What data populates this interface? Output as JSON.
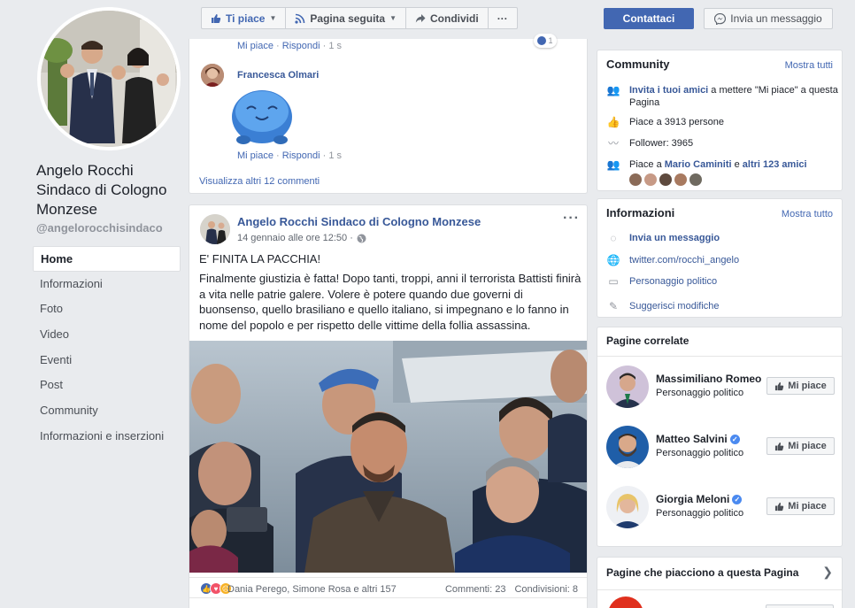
{
  "page": {
    "name": "Angelo Rocchi Sindaco di Cologno Monzese",
    "handle": "@angelorocchisindaco"
  },
  "nav": [
    {
      "label": "Home",
      "active": true
    },
    {
      "label": "Informazioni"
    },
    {
      "label": "Foto"
    },
    {
      "label": "Video"
    },
    {
      "label": "Eventi"
    },
    {
      "label": "Post"
    },
    {
      "label": "Community"
    },
    {
      "label": "Informazioni e inserzioni"
    }
  ],
  "actionbar": {
    "like_label": "Ti piace",
    "follow_label": "Pagina seguita",
    "share_label": "Condividi",
    "more_label": "···",
    "contact_label": "Contattaci",
    "message_label": "Invia un messaggio"
  },
  "comments": {
    "first_actions": {
      "like": "Mi piace",
      "reply": "Rispondi",
      "time": "1 s"
    },
    "reaction_count": "1",
    "commenter": "Francesca Olmari",
    "second_actions": {
      "like": "Mi piace",
      "reply": "Rispondi",
      "time": "1 s"
    },
    "view_more": "Visualizza altri 12 commenti",
    "separator": "·"
  },
  "post": {
    "author": "Angelo Rocchi Sindaco di Cologno Monzese",
    "date": "14 gennaio alle ore 12:50 ·",
    "headline": "E' FINITA LA PACCHIA!",
    "text": "Finalmente giustizia è fatta! Dopo tanti, troppi, anni il terrorista Battisti finirà a vita nelle patrie galere. Volere è potere quando due governi di buonsenso, quello brasiliano e quello italiano, si impegnano e lo fanno in nome del popolo e per rispetto delle vittime della follia assassina.",
    "reactions": "Dania Perego, Simone Rosa e altri 157",
    "comments_count": "Commenti: 23",
    "shares_count": "Condivisioni: 8"
  },
  "community": {
    "title": "Community",
    "see_all": "Mostra tutti",
    "invite_link": "Invita i tuoi amici",
    "invite_rest": " a mettere \"Mi piace\" a questa Pagina",
    "likes": "Piace a 3913 persone",
    "followers": "Follower: 3965",
    "friends_prefix": "Piace a ",
    "friends_name": "Mario Caminiti",
    "friends_mid": " e ",
    "friends_more": "altri 123 amici"
  },
  "info": {
    "title": "Informazioni",
    "see_all": "Mostra tutto",
    "message": "Invia un messaggio",
    "twitter": "twitter.com/rocchi_angelo",
    "category": "Personaggio politico",
    "suggest": "Suggerisci modifiche"
  },
  "related": {
    "title": "Pagine correlate",
    "like_label": "Mi piace",
    "items": [
      {
        "name": "Massimiliano Romeo",
        "category": "Personaggio politico",
        "verified": false
      },
      {
        "name": "Matteo Salvini",
        "category": "Personaggio politico",
        "verified": true
      },
      {
        "name": "Giorgia Meloni",
        "category": "Personaggio politico",
        "verified": true
      }
    ]
  },
  "liked_pages": {
    "title": "Pagine che piacciono a questa Pagina"
  },
  "colors": {
    "brand": "#4267b2",
    "background": "#e9ebee",
    "link": "#385898"
  }
}
